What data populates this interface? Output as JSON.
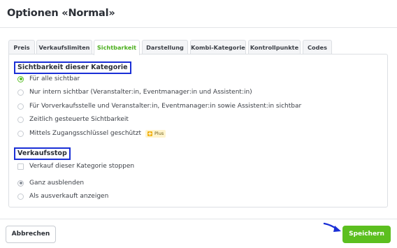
{
  "dialog": {
    "title": "Optionen «Normal»"
  },
  "tabs": [
    {
      "label": "Preis"
    },
    {
      "label": "Verkaufslimiten"
    },
    {
      "label": "Sichtbarkeit"
    },
    {
      "label": "Darstellung"
    },
    {
      "label": "Kombi-Kategorie"
    },
    {
      "label": "Kontrollpunkte"
    },
    {
      "label": "Codes"
    }
  ],
  "active_tab": "Sichtbarkeit",
  "visibility": {
    "heading": "Sichtbarkeit dieser Kategorie",
    "options": [
      {
        "label": "Für alle sichtbar",
        "selected": true
      },
      {
        "label": "Nur intern sichtbar (Veranstalter:in, Eventmanager:in und Assistent:in)",
        "selected": false
      },
      {
        "label": "Für Vorverkaufsstelle und Veranstalter:in, Eventmanager:in sowie Assistent:in sichtbar",
        "selected": false
      },
      {
        "label": "Zeitlich gesteuerte Sichtbarkeit",
        "selected": false
      },
      {
        "label": "Mittels Zugangsschlüssel geschützt",
        "selected": false,
        "badge": "Plus"
      }
    ]
  },
  "sales_stop": {
    "heading": "Verkaufsstop",
    "checkbox_label": "Verkauf dieser Kategorie stoppen",
    "checkbox_checked": false,
    "options": [
      {
        "label": "Ganz ausblenden",
        "selected": true
      },
      {
        "label": "Als ausverkauft anzeigen",
        "selected": false
      }
    ]
  },
  "footer": {
    "cancel_label": "Abbrechen",
    "save_label": "Speichern"
  },
  "colors": {
    "accent": "#5cbf1f",
    "highlight_box": "#1a2fd6",
    "arrow": "#1a2fd6"
  }
}
